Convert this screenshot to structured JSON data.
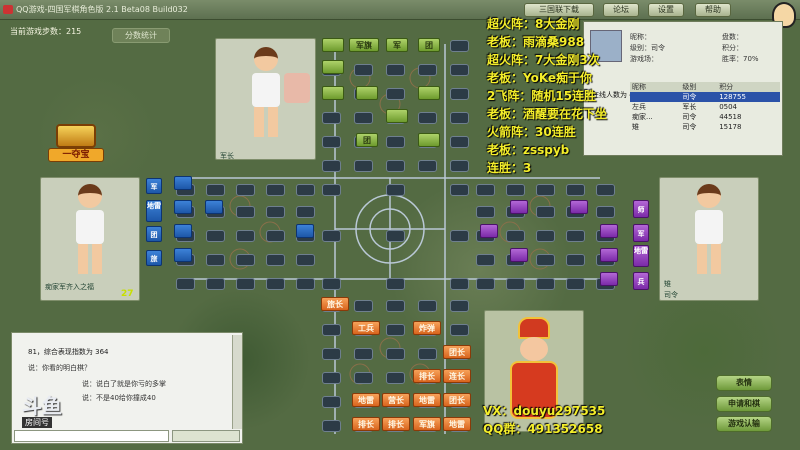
{
  "window": {
    "title": "QQ游戏-四国军棋角色版 2.1 Beta08 Build032",
    "buttons": [
      "三国联下载",
      "论坛",
      "设置",
      "帮助"
    ]
  },
  "game": {
    "steps_label": "当前游戏步数：215",
    "stats_button": "分数统计",
    "treasure": "一夺宝",
    "rank_top": "军长",
    "name_left": "痴家军齐入之福",
    "score_left": "27",
    "rank_right": "司令",
    "name_right": "雉"
  },
  "overlay": {
    "lines": [
      "超火阵：8大金刚",
      "老板：雨滴桑988",
      "超火阵：7大金刚3次",
      "老板：YoKe痴于你",
      "2飞阵：随机15连胜",
      "老板：酒醒要在花下坐",
      "火箭阵：30连胜",
      "老板：zsspyb",
      "连胜：3"
    ],
    "contact": [
      "VX：douyu297535",
      "QQ群：491352658"
    ]
  },
  "info": {
    "nick_label": "昵称：",
    "rank_label": "级别：司令",
    "games_label": "游戏场：",
    "disk_label": "盘数：",
    "points_label": "积分：",
    "rate_label": "胜率：70%",
    "online_label": "在线人数为 4",
    "columns": [
      "昵称",
      "级别",
      "积分"
    ],
    "rows": [
      [
        "",
        "司令",
        "128755"
      ],
      [
        "左兵",
        "军长",
        "0504"
      ],
      [
        "痴家...",
        "司令",
        "44518"
      ],
      [
        "雉",
        "司令",
        "15178"
      ]
    ]
  },
  "board": {
    "top_pieces": [
      "军旗",
      "军",
      "团",
      "团"
    ],
    "left_pieces": [
      "军",
      "地雷",
      "团",
      "旅"
    ],
    "right_pieces": [
      "师",
      "军",
      "地雷",
      "兵"
    ],
    "bottom_pieces": [
      "旅长",
      "工兵",
      "炸弹",
      "团长",
      "排长",
      "连长",
      "地雷",
      "营长",
      "地雷",
      "团长",
      "排长",
      "排长",
      "军旗",
      "地雷"
    ]
  },
  "chat": {
    "lines": [
      "81，综合表现指数为 364",
      "说：你看的明白棋？",
      "说：说白了就是你亏的多掌",
      "说：不是40给你撞成40"
    ],
    "logo": "斗鱼",
    "room": "房间号"
  },
  "right_buttons": [
    "表情",
    "申请和棋",
    "游戏认输"
  ]
}
